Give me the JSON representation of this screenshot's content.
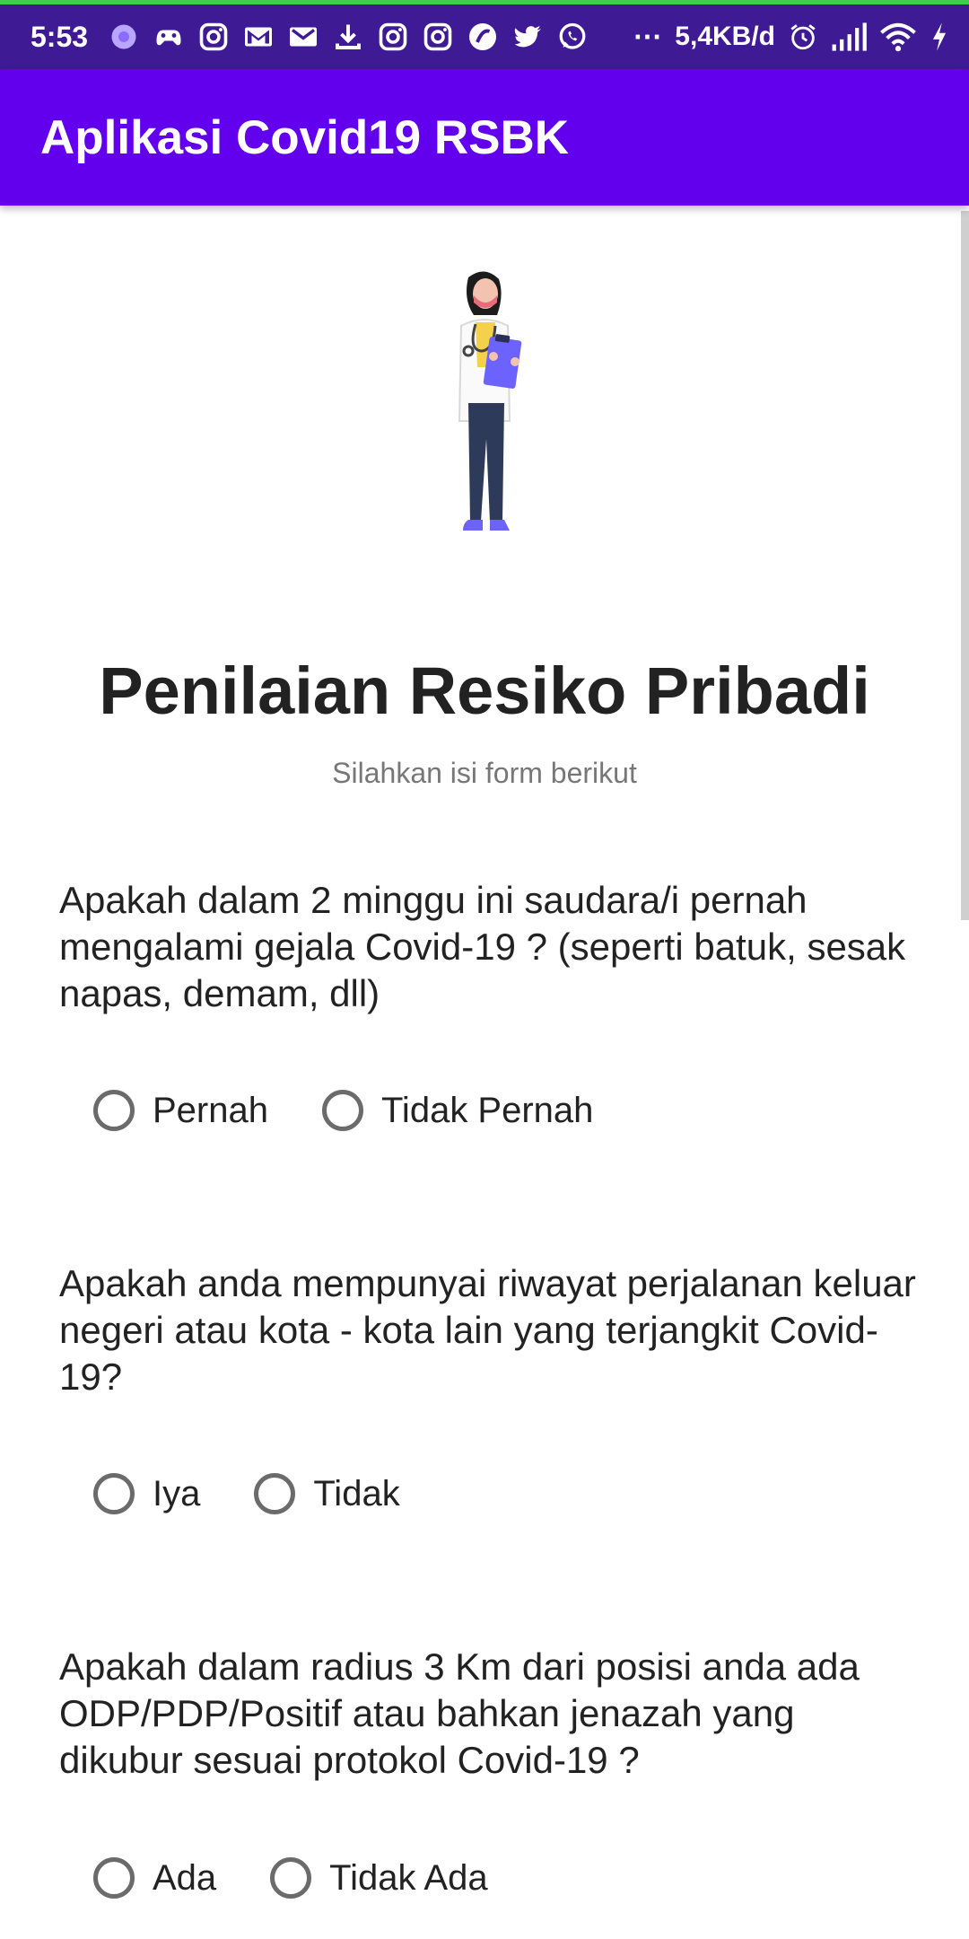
{
  "status_bar": {
    "time": "5:53",
    "network_speed": "5,4KB/d",
    "notification_icons": [
      "loading-icon",
      "game-controller-icon",
      "instagram-icon",
      "gmail-icon",
      "gmail-icon",
      "download-icon",
      "instagram-icon",
      "instagram-icon",
      "music-icon",
      "twitter-icon",
      "whatsapp-icon"
    ],
    "more_symbol": "···"
  },
  "app_bar": {
    "title": "Aplikasi Covid19 RSBK"
  },
  "header": {
    "title": "Penilaian Resiko Pribadi",
    "subtitle": "Silahkan isi form berikut"
  },
  "questions": [
    {
      "text": "Apakah dalam 2 minggu ini saudara/i pernah mengalami gejala Covid-19 ? (seperti batuk, sesak napas, demam, dll)",
      "options": [
        "Pernah",
        "Tidak Pernah"
      ]
    },
    {
      "text": "Apakah anda mempunyai riwayat perjalanan keluar negeri atau kota - kota lain yang terjangkit Covid-19?",
      "options": [
        "Iya",
        "Tidak"
      ]
    },
    {
      "text": "Apakah dalam radius 3 Km dari posisi anda ada ODP/PDP/Positif atau bahkan jenazah yang dikubur sesuai protokol Covid-19 ?",
      "options": [
        "Ada",
        "Tidak Ada"
      ]
    }
  ],
  "colors": {
    "primary": "#6200ee",
    "status_bar": "#3e1a94",
    "radio_border": "#6b6b6b"
  }
}
